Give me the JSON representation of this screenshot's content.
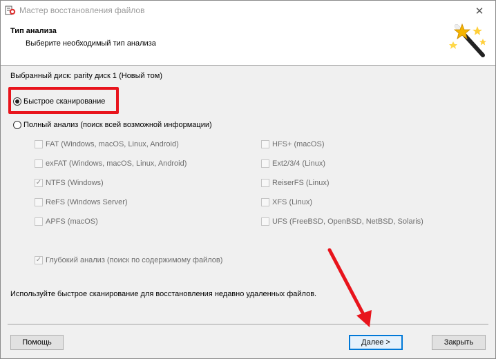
{
  "window": {
    "title": "Мастер восстановления файлов"
  },
  "header": {
    "title": "Тип анализа",
    "subtitle": "Выберите необходимый тип анализа"
  },
  "disk": {
    "label": "Выбранный диск: parity диск 1 (Новый том)"
  },
  "modes": {
    "quick": {
      "label": "Быстрое сканирование",
      "selected": true
    },
    "full": {
      "label": "Полный анализ (поиск всей возможной информации)",
      "selected": false
    }
  },
  "filesystems": {
    "left": [
      {
        "label": "FAT (Windows, macOS, Linux, Android)",
        "checked": false
      },
      {
        "label": "exFAT (Windows, macOS, Linux, Android)",
        "checked": false
      },
      {
        "label": "NTFS (Windows)",
        "checked": true
      },
      {
        "label": "ReFS (Windows Server)",
        "checked": false
      },
      {
        "label": "APFS (macOS)",
        "checked": false
      }
    ],
    "right": [
      {
        "label": "HFS+ (macOS)",
        "checked": false
      },
      {
        "label": "Ext2/3/4 (Linux)",
        "checked": false
      },
      {
        "label": "ReiserFS (Linux)",
        "checked": false
      },
      {
        "label": "XFS (Linux)",
        "checked": false
      },
      {
        "label": "UFS (FreeBSD, OpenBSD, NetBSD, Solaris)",
        "checked": false
      }
    ]
  },
  "deep": {
    "label": "Глубокий анализ (поиск по содержимому файлов)",
    "checked": true
  },
  "hint": "Используйте быстрое сканирование для восстановления недавно удаленных файлов.",
  "buttons": {
    "help": "Помощь",
    "next": "Далее >",
    "close": "Закрыть"
  },
  "annotation": {
    "color": "#e8141c"
  }
}
